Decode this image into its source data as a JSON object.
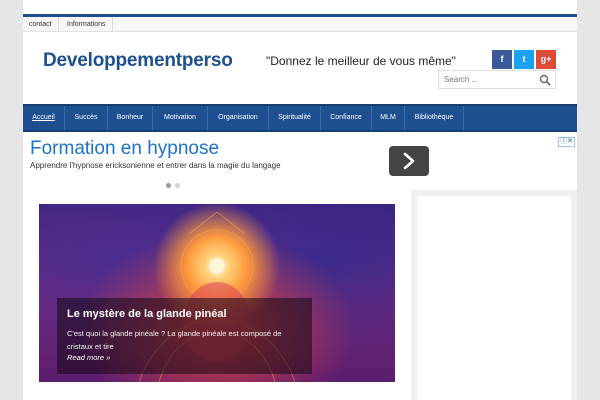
{
  "topbar": {
    "links": [
      "contact",
      "Informations"
    ]
  },
  "header": {
    "site_title": "Developpementperso",
    "tagline": "\"Donnez le meilleur de vous même\"",
    "social": {
      "facebook": "f",
      "twitter": "t",
      "googleplus": "g+"
    },
    "search_placeholder": "Search ..."
  },
  "nav": {
    "items": [
      "Accueil",
      "Succès",
      "Bonheur",
      "Motivation",
      "Organisation",
      "Spiritualité",
      "Confiance",
      "MLM",
      "Bibliothèque"
    ],
    "active": "Accueil"
  },
  "ad": {
    "title": "Formation en hypnose",
    "subtitle": "Apprendre l'hypnose ericksonienne et entrer dans la magie du langage",
    "dot_colors": [
      "#999999",
      "#d0d0d0"
    ]
  },
  "slider": {
    "title": "Le mystère de la glande pinéal",
    "excerpt": "C'est quoi la glande pinéale ? La glande pinéale est composé de cristaux et tire",
    "read_more": "Read more »"
  },
  "colors": {
    "brand": "#1d4f91",
    "ad_link": "#1a73c8"
  }
}
